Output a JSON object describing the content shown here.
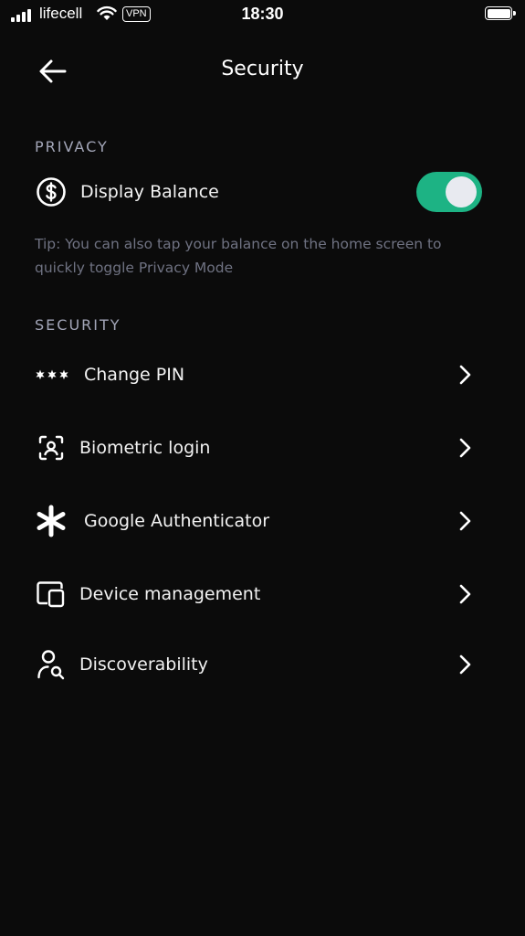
{
  "status_bar": {
    "carrier": "lifecell",
    "vpn": "VPN",
    "time": "18:30"
  },
  "header": {
    "title": "Security"
  },
  "privacy": {
    "section_label": "PRIVACY",
    "display_balance_label": "Display Balance",
    "display_balance_on": true,
    "tip": "Tip: You can also tap your balance on the home screen to quickly toggle Privacy Mode"
  },
  "security": {
    "section_label": "SECURITY",
    "items": [
      {
        "label": "Change PIN",
        "icon": "pin-dots-icon"
      },
      {
        "label": "Biometric login",
        "icon": "face-scan-icon"
      },
      {
        "label": "Google Authenticator",
        "icon": "asterisk-icon"
      },
      {
        "label": "Device management",
        "icon": "devices-icon"
      },
      {
        "label": "Discoverability",
        "icon": "user-search-icon"
      }
    ]
  },
  "colors": {
    "background": "#0b0b0b",
    "toggle_on": "#1db384",
    "section_label": "#a3a6b8",
    "tip_text": "#6f7282"
  }
}
